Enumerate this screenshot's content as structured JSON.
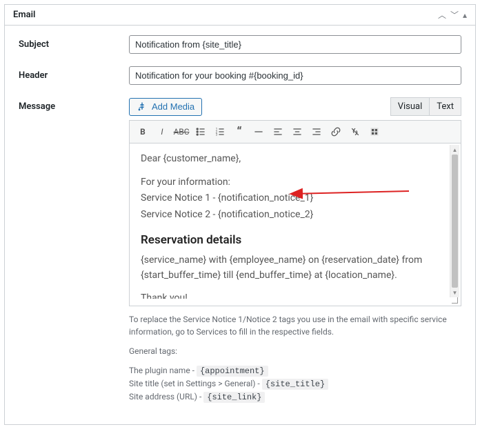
{
  "panel": {
    "title": "Email"
  },
  "fields": {
    "subject": {
      "label": "Subject",
      "value": "Notification from {site_title}"
    },
    "header": {
      "label": "Header",
      "value": "Notification for your booking #{booking_id}"
    },
    "message": {
      "label": "Message"
    }
  },
  "media": {
    "add_label": "Add Media"
  },
  "tabs": {
    "visual": "Visual",
    "text": "Text"
  },
  "editor_body": {
    "line1": "Dear {customer_name},",
    "info": "For your information:",
    "notice1": "Service Notice 1 - {notification_notice_1}",
    "notice2": "Service Notice 2 - {notification_notice_2}",
    "heading": "Reservation details",
    "details": "{service_name} with {employee_name} on {reservation_date} from {start_buffer_time} till {end_buffer_time} at {location_name}.",
    "thanks": "Thank you!"
  },
  "help": {
    "notice": "To replace the Service Notice 1/Notice 2 tags you use in the email with specific service information, go to Services to fill in the respective fields.",
    "general_title": "General tags:",
    "plugin_label": "The plugin name - ",
    "plugin_tag": "{appointment}",
    "sitetitle_label": "Site title (set in Settings > General) - ",
    "sitetitle_tag": "{site_title}",
    "siteurl_label": "Site address (URL) - ",
    "siteurl_tag": "{site_link}"
  }
}
